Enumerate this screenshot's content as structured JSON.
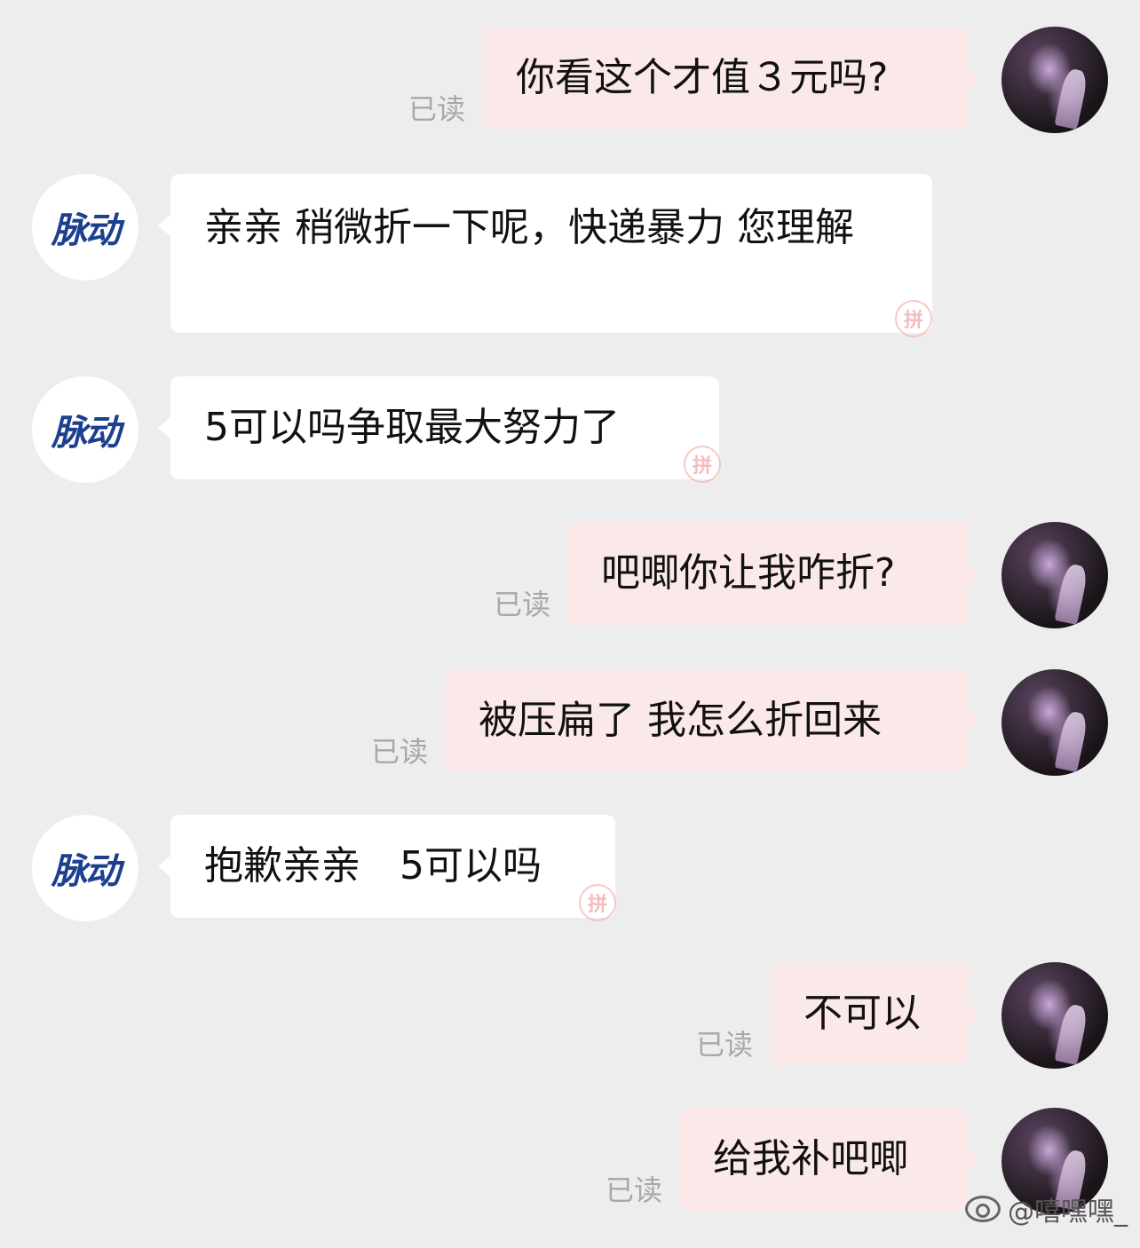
{
  "brand": {
    "logo_text": "脉动"
  },
  "read_label": "已读",
  "stamp_glyph": "拼",
  "messages": [
    {
      "sender": "user",
      "text": "你看这个才值３元吗?"
    },
    {
      "sender": "brand",
      "text": "亲亲 稍微折一下呢，快递暴力 您理解"
    },
    {
      "sender": "brand",
      "text": "5可以吗争取最大努力了"
    },
    {
      "sender": "user",
      "text": "吧唧你让我咋折?"
    },
    {
      "sender": "user",
      "text": "被压扁了 我怎么折回来"
    },
    {
      "sender": "brand",
      "text": "抱歉亲亲　5可以吗"
    },
    {
      "sender": "user",
      "text": "不可以"
    },
    {
      "sender": "user",
      "text": "给我补吧唧"
    }
  ],
  "watermark": {
    "text": "@嘻嘿嘿_",
    "icon": "weibo-icon"
  }
}
